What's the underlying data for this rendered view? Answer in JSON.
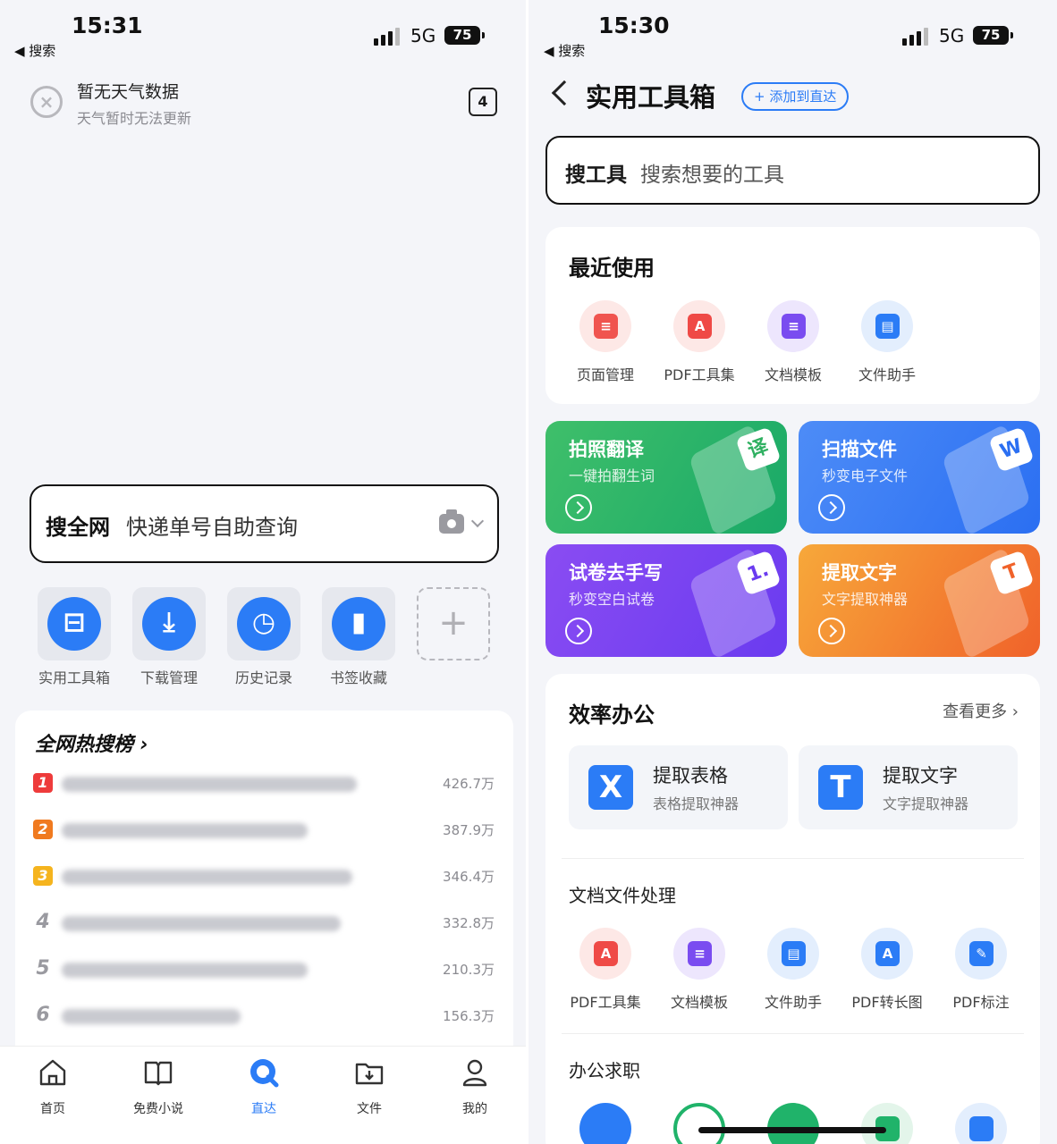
{
  "left": {
    "status": {
      "time": "15:31",
      "back_app": "◀ 搜索",
      "network": "5G",
      "battery": "75"
    },
    "weather": {
      "icon": "close-circle-icon",
      "title": "暂无天气数据",
      "subtitle": "天气暂时无法更新"
    },
    "tab_count": "4",
    "search": {
      "label": "搜全网",
      "placeholder": "快递单号自助查询",
      "camera_icon": "camera-icon"
    },
    "quick_links": [
      {
        "label": "实用工具箱",
        "icon": "toolbox-icon",
        "glyph": "⊟"
      },
      {
        "label": "下载管理",
        "icon": "download-icon",
        "glyph": "⤓"
      },
      {
        "label": "历史记录",
        "icon": "clock-icon",
        "glyph": "◷"
      },
      {
        "label": "书签收藏",
        "icon": "bookmark-icon",
        "glyph": "▮"
      }
    ],
    "add_glyph": "+",
    "hot_list": {
      "title": "全网热搜榜 ›",
      "items": [
        {
          "rank": "1",
          "heat": "426.7万",
          "color": "#ee3b3b"
        },
        {
          "rank": "2",
          "heat": "387.9万",
          "color": "#f07a1f"
        },
        {
          "rank": "3",
          "heat": "346.4万",
          "color": "#f5b41e"
        },
        {
          "rank": "4",
          "heat": "332.8万",
          "color": ""
        },
        {
          "rank": "5",
          "heat": "210.3万",
          "color": ""
        },
        {
          "rank": "6",
          "heat": "156.3万",
          "color": ""
        }
      ]
    },
    "tabs": [
      {
        "label": "首页",
        "icon": "home-icon"
      },
      {
        "label": "免费小说",
        "icon": "book-icon"
      },
      {
        "label": "直达",
        "icon": "direct-icon"
      },
      {
        "label": "文件",
        "icon": "file-download-icon"
      },
      {
        "label": "我的",
        "icon": "profile-icon"
      }
    ]
  },
  "right": {
    "status": {
      "time": "15:30",
      "back_app": "◀ 搜索",
      "network": "5G",
      "battery": "75"
    },
    "nav": {
      "title": "实用工具箱",
      "add_button": "+ 添加到直达"
    },
    "search": {
      "label": "搜工具",
      "placeholder": "搜索想要的工具"
    },
    "recent": {
      "title": "最近使用",
      "tools": [
        {
          "label": "页面管理",
          "icon": "page-manage-icon",
          "glyph": "≡",
          "color": "#f0544f",
          "bg": "#fde8e6"
        },
        {
          "label": "PDF工具集",
          "icon": "pdf-icon",
          "glyph": "A",
          "color": "#ef4a46",
          "bg": "#fde8e6"
        },
        {
          "label": "文档模板",
          "icon": "doc-template-icon",
          "glyph": "≡",
          "color": "#7a4cf0",
          "bg": "#ede6fd"
        },
        {
          "label": "文件助手",
          "icon": "file-helper-icon",
          "glyph": "▤",
          "color": "#2b7cf6",
          "bg": "#e3eefd"
        }
      ]
    },
    "banners": [
      {
        "title": "拍照翻译",
        "subtitle": "一键拍翻生词",
        "badge": "译",
        "colors": [
          "#3fbf6a",
          "#19a968"
        ],
        "badge_color": "#2fb061"
      },
      {
        "title": "扫描文件",
        "subtitle": "秒变电子文件",
        "badge": "W",
        "colors": [
          "#4d8cf7",
          "#2b6ff2"
        ],
        "badge_color": "#2b6ff2"
      },
      {
        "title": "试卷去手写",
        "subtitle": "秒变空白试卷",
        "badge": "1.",
        "colors": [
          "#8a4cf2",
          "#6a3bf0"
        ],
        "badge_color": "#6a3bf0"
      },
      {
        "title": "提取文字",
        "subtitle": "文字提取神器",
        "badge": "T",
        "colors": [
          "#f7a83a",
          "#f0622a"
        ],
        "badge_color": "#f0622a"
      }
    ],
    "office": {
      "title": "效率办公",
      "more": "查看更多 ›",
      "cards": [
        {
          "title": "提取表格",
          "subtitle": "表格提取神器",
          "letter": "X",
          "icon": "extract-table-icon",
          "color": "#2b7cf6"
        },
        {
          "title": "提取文字",
          "subtitle": "文字提取神器",
          "letter": "T",
          "icon": "extract-text-icon",
          "color": "#2b7cf6"
        }
      ],
      "doc_section": {
        "title": "文档文件处理",
        "tools": [
          {
            "label": "PDF工具集",
            "icon": "pdf-icon",
            "glyph": "A",
            "color": "#ef4a46",
            "bg": "#fde8e6"
          },
          {
            "label": "文档模板",
            "icon": "doc-template-icon",
            "glyph": "≡",
            "color": "#7a4cf0",
            "bg": "#ede6fd"
          },
          {
            "label": "文件助手",
            "icon": "file-helper-icon",
            "glyph": "▤",
            "color": "#2b7cf6",
            "bg": "#e3eefd"
          },
          {
            "label": "PDF转长图",
            "icon": "pdf-long-image-icon",
            "glyph": "A",
            "color": "#2b7cf6",
            "bg": "#e3eefd"
          },
          {
            "label": "PDF标注",
            "icon": "pdf-annotate-icon",
            "glyph": "✎",
            "color": "#2b7cf6",
            "bg": "#e3eefd"
          }
        ]
      },
      "job_section": {
        "title": "办公求职",
        "tools": [
          {
            "icon": "meeting-icon",
            "color": "#2b7cf6",
            "bg": "#2b7cf6"
          },
          {
            "icon": "resume-check-icon",
            "color": "#20b36a",
            "bg": "#ffffff"
          },
          {
            "icon": "scan-icon",
            "color": "#20b36a",
            "bg": "#20b36a"
          },
          {
            "icon": "job-person-icon",
            "color": "#20b36a",
            "bg": "#e3f5ea"
          },
          {
            "icon": "id-photo-icon",
            "color": "#2b7cf6",
            "bg": "#e3eefd"
          }
        ]
      }
    }
  }
}
